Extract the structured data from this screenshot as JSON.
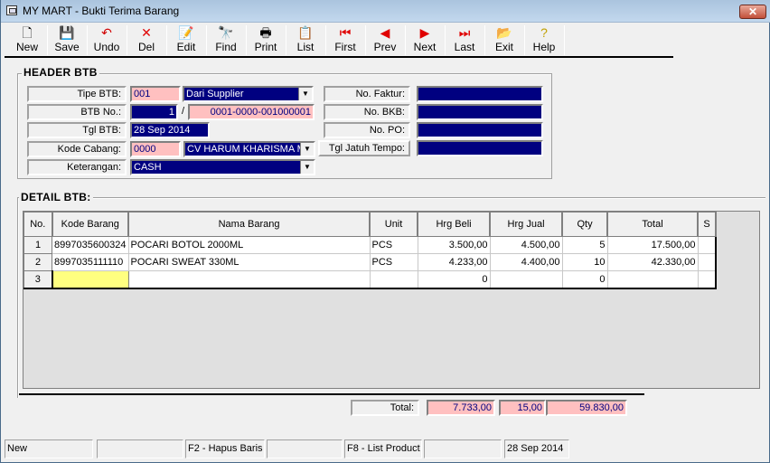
{
  "window": {
    "title": "MY MART - Bukti Terima Barang",
    "close_label": "✕"
  },
  "toolbar": [
    {
      "id": "new",
      "label": "New",
      "icon": "🗋",
      "color": "#000"
    },
    {
      "id": "save",
      "label": "Save",
      "icon": "💾",
      "color": "#000"
    },
    {
      "id": "undo",
      "label": "Undo",
      "icon": "↶",
      "color": "#d00000"
    },
    {
      "id": "del",
      "label": "Del",
      "icon": "✕",
      "color": "#e00000"
    },
    {
      "id": "edit",
      "label": "Edit",
      "icon": "📝",
      "color": "#000"
    },
    {
      "id": "find",
      "label": "Find",
      "icon": "🔭",
      "color": "#000"
    },
    {
      "id": "print",
      "label": "Print",
      "icon": "🖶",
      "color": "#000"
    },
    {
      "id": "list",
      "label": "List",
      "icon": "📋",
      "color": "#000"
    },
    {
      "id": "first",
      "label": "First",
      "icon": "⏮",
      "color": "#e00000"
    },
    {
      "id": "prev",
      "label": "Prev",
      "icon": "◀",
      "color": "#e00000"
    },
    {
      "id": "next",
      "label": "Next",
      "icon": "▶",
      "color": "#e00000"
    },
    {
      "id": "last",
      "label": "Last",
      "icon": "⏭",
      "color": "#e00000"
    },
    {
      "id": "exit",
      "label": "Exit",
      "icon": "📂",
      "color": "#806000"
    },
    {
      "id": "help",
      "label": "Help",
      "icon": "?",
      "color": "#c0a000"
    }
  ],
  "header": {
    "title": "HEADER BTB",
    "tipe_btb": {
      "label": "Tipe BTB:",
      "code": "001",
      "value": "Dari Supplier"
    },
    "btb_no": {
      "label": "BTB No.:",
      "number": "1",
      "separator": "/",
      "full": "0001-0000-001000001"
    },
    "tgl_btb": {
      "label": "Tgl BTB:",
      "value": "28 Sep 2014"
    },
    "kode_cabang": {
      "label": "Kode Cabang:",
      "code": "0000",
      "value": "CV HARUM KHARISMA M"
    },
    "keterangan": {
      "label": "Keterangan:",
      "value": "CASH"
    },
    "no_faktur": {
      "label": "No. Faktur:",
      "value": ""
    },
    "no_bkb": {
      "label": "No. BKB:",
      "value": ""
    },
    "no_po": {
      "label": "No. PO:",
      "value": ""
    },
    "tgl_jatuh_tempo": {
      "label": "Tgl Jatuh Tempo:",
      "value": ""
    }
  },
  "detail": {
    "title": "DETAIL BTB:",
    "columns": [
      "No.",
      "Kode Barang",
      "Nama Barang",
      "Unit",
      "Hrg Beli",
      "Hrg Jual",
      "Qty",
      "Total",
      "S"
    ],
    "rows": [
      {
        "no": "1",
        "kode": "8997035600324",
        "nama": "POCARI BOTOL 2000ML",
        "unit": "PCS",
        "hrg_beli": "3.500,00",
        "hrg_jual": "4.500,00",
        "qty": "5",
        "total": "17.500,00",
        "s": ""
      },
      {
        "no": "2",
        "kode": "8997035111110",
        "nama": "POCARI SWEAT 330ML",
        "unit": "PCS",
        "hrg_beli": "4.233,00",
        "hrg_jual": "4.400,00",
        "qty": "10",
        "total": "42.330,00",
        "s": ""
      },
      {
        "no": "3",
        "kode": "",
        "nama": "",
        "unit": "",
        "hrg_beli": "0",
        "hrg_jual": "",
        "qty": "0",
        "total": "",
        "s": ""
      }
    ]
  },
  "totals": {
    "label": "Total:",
    "hrg_beli": "7.733,00",
    "qty": "15,00",
    "total": "59.830,00"
  },
  "statusbar": [
    "New",
    "",
    "F2 - Hapus Baris",
    "",
    "F8 - List Product",
    "",
    "28 Sep 2014"
  ]
}
